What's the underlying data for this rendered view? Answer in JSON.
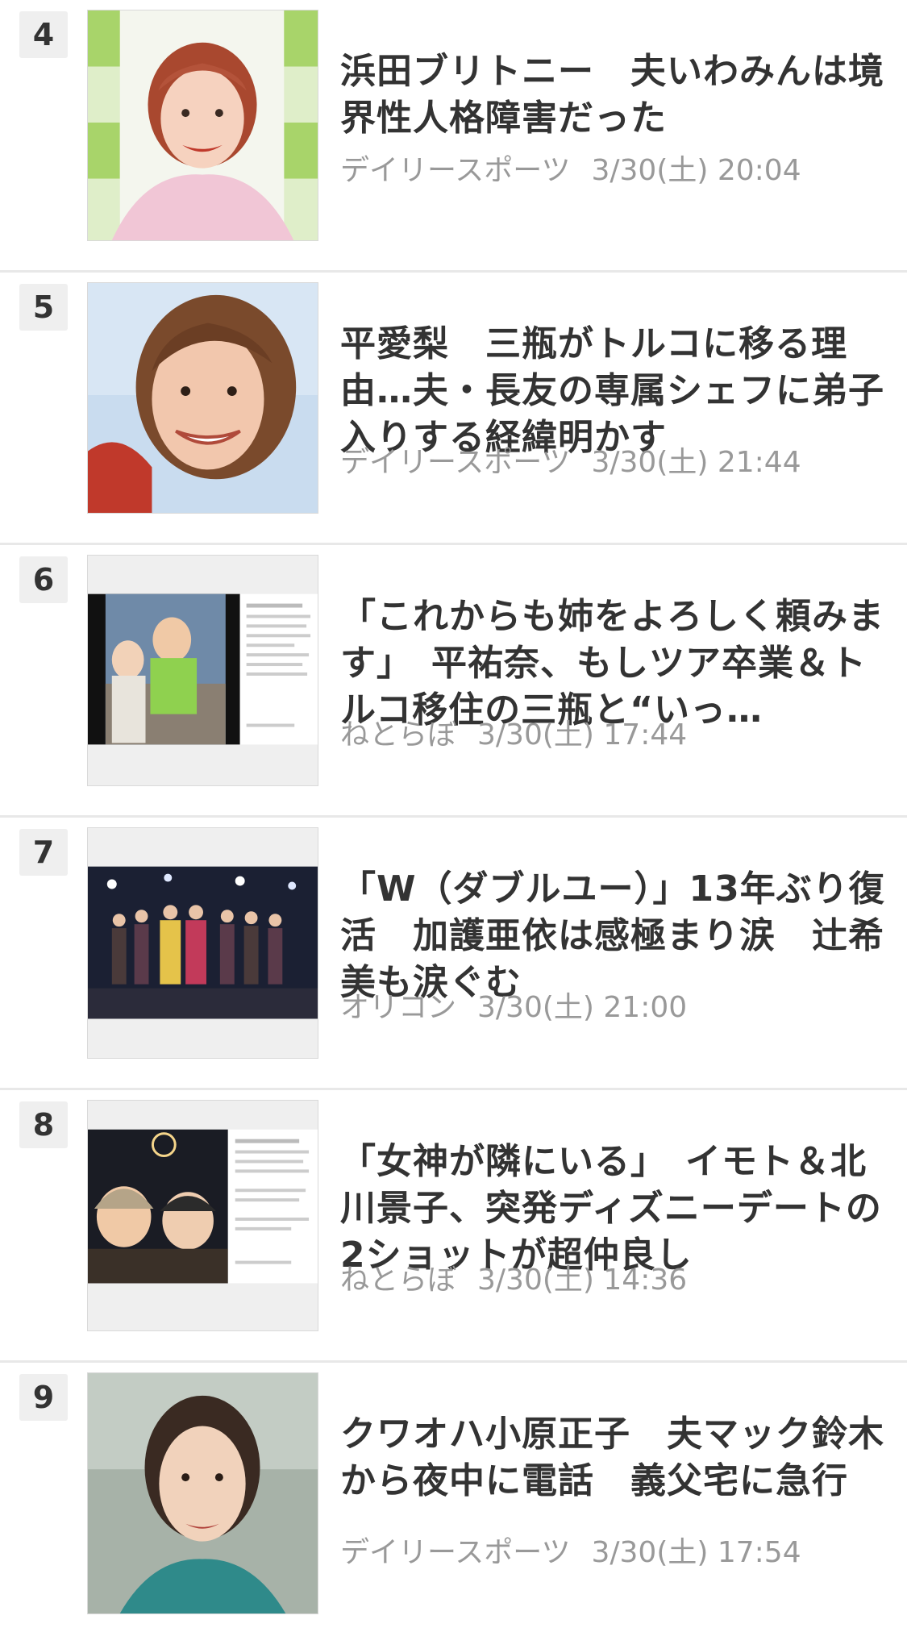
{
  "articles": [
    {
      "rank": "4",
      "title": "浜田ブリトニー　夫いわみんは境界性人格障害だった",
      "source": "デイリースポーツ",
      "datetime": "3/30(土) 20:04",
      "thumb_icon": "woman-portrait-photo"
    },
    {
      "rank": "5",
      "title": "平愛梨　三瓶がトルコに移る理由…夫・長友の専属シェフに弟子入りする経緯明かす",
      "source": "デイリースポーツ",
      "datetime": "3/30(土) 21:44",
      "thumb_icon": "smiling-woman-photo"
    },
    {
      "rank": "6",
      "title": "「これからも姉をよろしく頼みます」　平祐奈、もしツア卒業＆トルコ移住の三瓶と“いっ…",
      "source": "ねとらぼ",
      "datetime": "3/30(土) 17:44",
      "thumb_icon": "instagram-post-screenshot"
    },
    {
      "rank": "7",
      "title": "「W（ダブルユー）」13年ぶり復活　加護亜依は感極まり涙　辻希美も涙ぐむ",
      "source": "オリコン",
      "datetime": "3/30(土) 21:00",
      "thumb_icon": "concert-stage-photo"
    },
    {
      "rank": "8",
      "title": "「女神が隣にいる」　イモト＆北川景子、突発ディズニーデートの2ショットが超仲良し",
      "source": "ねとらぼ",
      "datetime": "3/30(土) 14:36",
      "thumb_icon": "instagram-post-screenshot"
    },
    {
      "rank": "9",
      "title": "クワオハ小原正子　夫マック鈴木から夜中に電話　義父宅に急行",
      "source": "デイリースポーツ",
      "datetime": "3/30(土) 17:54",
      "thumb_icon": "woman-portrait-photo"
    }
  ]
}
